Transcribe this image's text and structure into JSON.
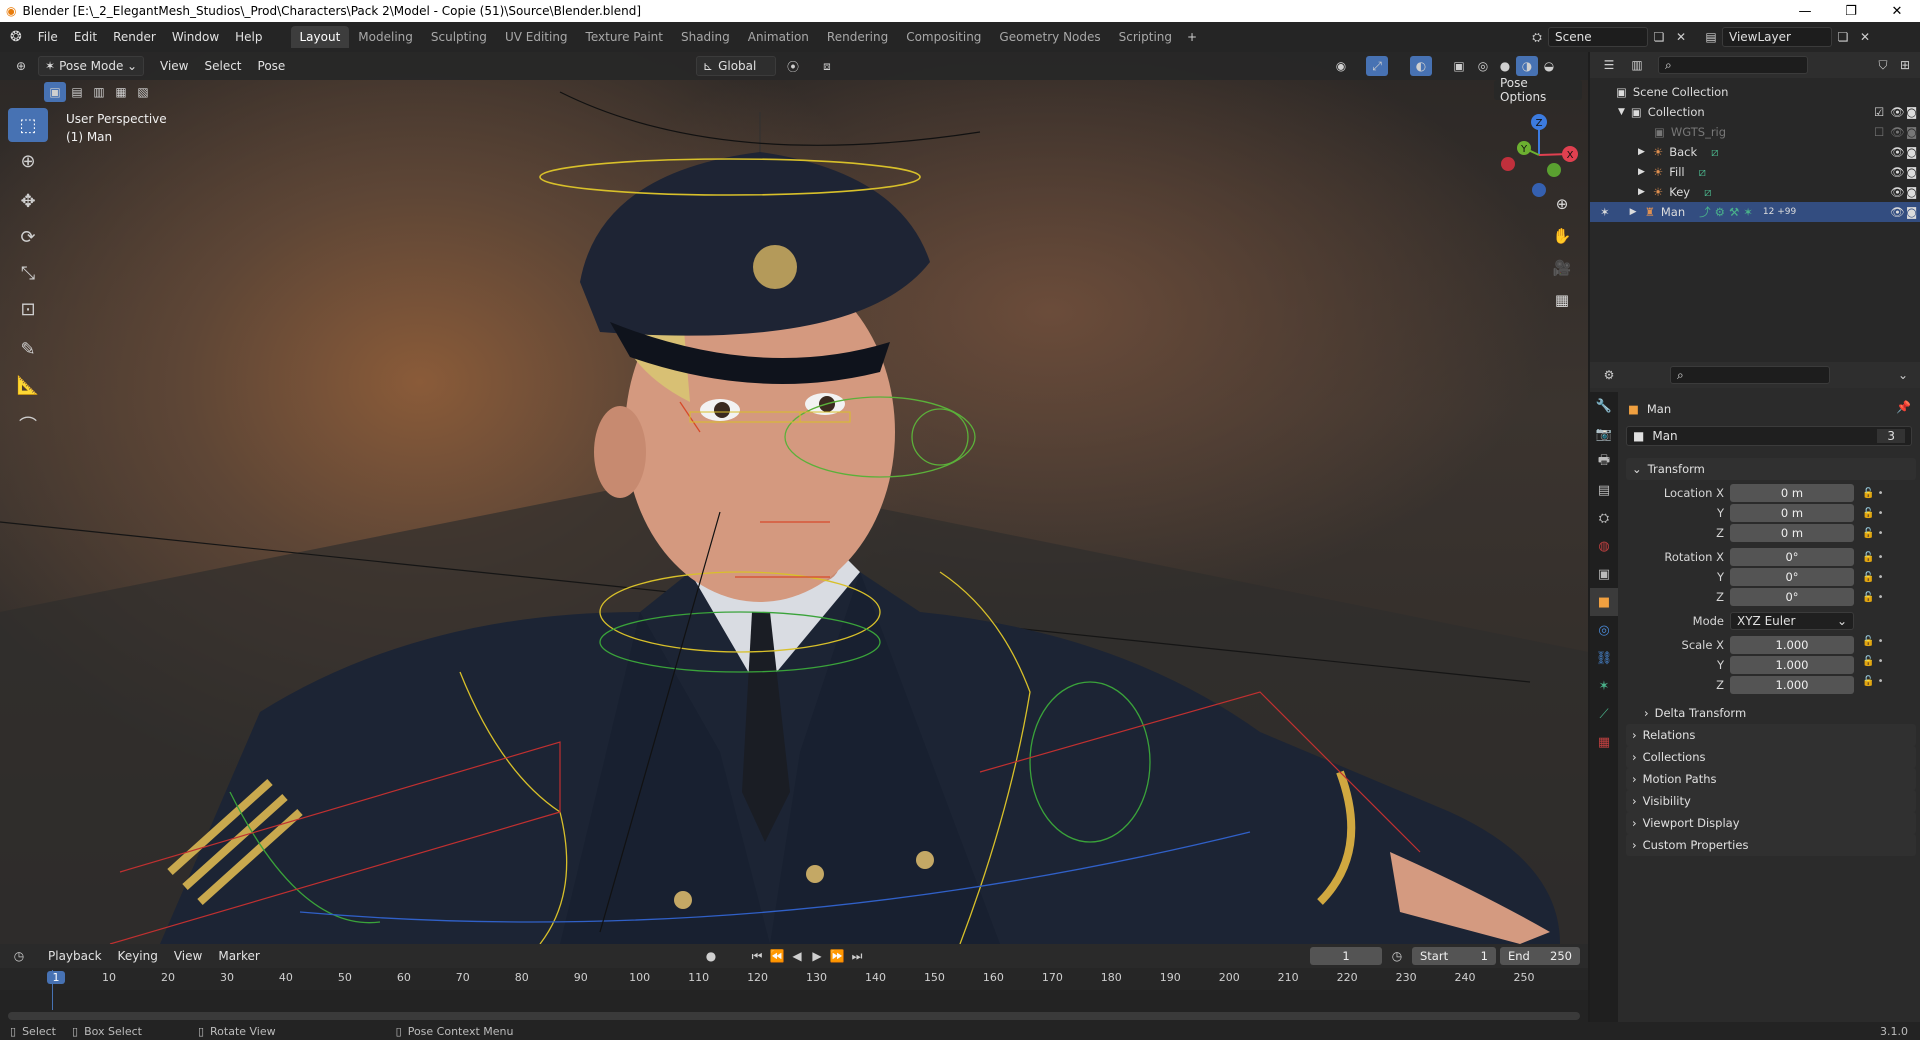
{
  "window": {
    "title": "Blender [E:\\_2_ElegantMesh_Studios\\_Prod\\Characters\\Pack 2\\Model - Copie (51)\\Source\\Blender.blend]",
    "controls": [
      "—",
      "❐",
      "✕"
    ]
  },
  "menu": [
    "File",
    "Edit",
    "Render",
    "Window",
    "Help"
  ],
  "workspaces": [
    "Layout",
    "Modeling",
    "Sculpting",
    "UV Editing",
    "Texture Paint",
    "Shading",
    "Animation",
    "Rendering",
    "Compositing",
    "Geometry Nodes",
    "Scripting"
  ],
  "active_workspace": "Layout",
  "scene_field": "Scene",
  "viewlayer_field": "ViewLayer",
  "viewport_header": {
    "mode": "Pose Mode",
    "menus": [
      "View",
      "Select",
      "Pose"
    ],
    "orientation": "Global",
    "pose_options": "Pose Options"
  },
  "viewport": {
    "perspective": "User Perspective",
    "object": "(1) Man"
  },
  "gizmo": {
    "z": "Z",
    "y": "Y",
    "x": "X"
  },
  "outliner": {
    "root": "Scene Collection",
    "items": [
      {
        "label": "Collection",
        "depth": 1
      },
      {
        "label": "WGTS_rig",
        "depth": 2
      },
      {
        "label": "Back",
        "depth": 2
      },
      {
        "label": "Fill",
        "depth": 2
      },
      {
        "label": "Key",
        "depth": 2
      },
      {
        "label": "Man",
        "depth": 2,
        "badge": "12 +99"
      }
    ]
  },
  "properties": {
    "object_name": "Man",
    "data_name": "Man",
    "users": "3",
    "transform_label": "Transform",
    "location": {
      "label": "Location X",
      "x": "0 m",
      "y": "0 m",
      "z": "0 m"
    },
    "rotation": {
      "label": "Rotation X",
      "x": "0°",
      "y": "0°",
      "z": "0°"
    },
    "mode_label": "Mode",
    "mode_value": "XYZ Euler",
    "scale": {
      "label": "Scale X",
      "x": "1.000",
      "y": "1.000",
      "z": "1.000"
    },
    "axis_y": "Y",
    "axis_z": "Z",
    "subpanels": [
      "Delta Transform",
      "Relations",
      "Collections",
      "Motion Paths",
      "Visibility",
      "Viewport Display",
      "Custom Properties"
    ]
  },
  "timeline": {
    "menus": [
      "Playback",
      "Keying",
      "View",
      "Marker"
    ],
    "current_frame": "1",
    "start_label": "Start",
    "start": "1",
    "end_label": "End",
    "end": "250",
    "ruler": [
      "1",
      "10",
      "20",
      "30",
      "40",
      "50",
      "60",
      "70",
      "80",
      "90",
      "100",
      "110",
      "120",
      "130",
      "140",
      "150",
      "160",
      "170",
      "180",
      "190",
      "200",
      "210",
      "220",
      "230",
      "240",
      "250"
    ]
  },
  "statusbar": {
    "select": "Select",
    "box_select": "Box Select",
    "rotate_view": "Rotate View",
    "context_menu": "Pose Context Menu",
    "version": "3.1.0"
  },
  "colors": {
    "accent": "#4772b3",
    "selected_row": "#334d80",
    "active_frame": "#4772b3"
  }
}
